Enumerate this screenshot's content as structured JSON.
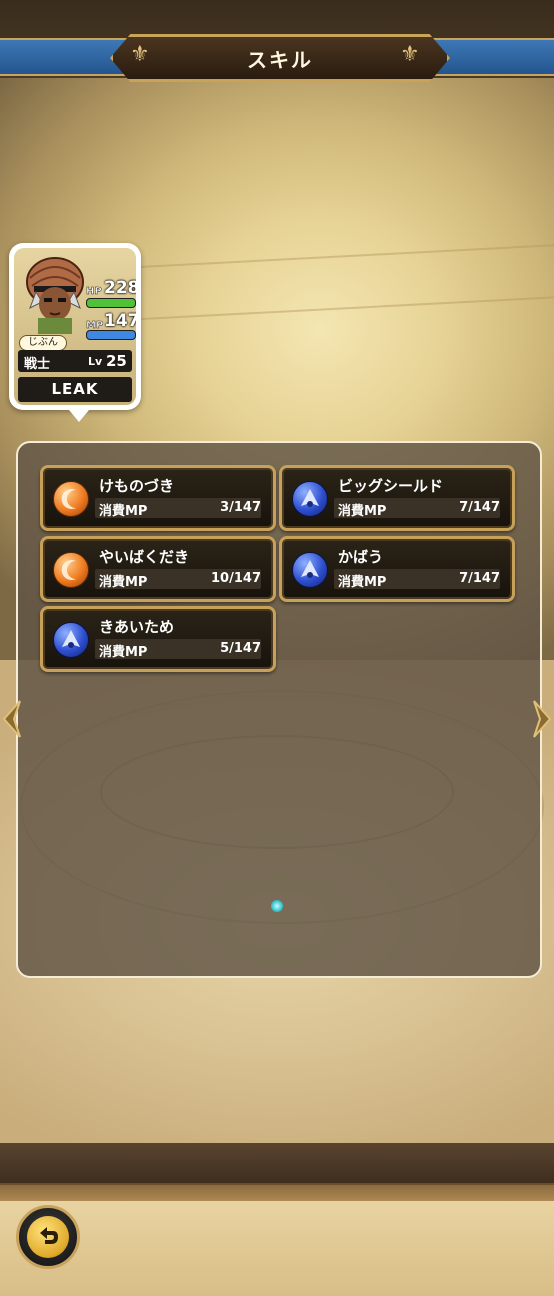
{
  "header": {
    "title": "スキル"
  },
  "character": {
    "hp_label": "HP",
    "hp": "228",
    "mp_label": "MP",
    "mp": "147",
    "tag": "じぶん",
    "class": "戦士",
    "level_prefix": "Lv",
    "level": "25",
    "name": "LEAK"
  },
  "skills": [
    {
      "name": "けものづき",
      "cost_label": "消費MP",
      "cost": "3/147",
      "icon": "orange-crescent-icon"
    },
    {
      "name": "ビッグシールド",
      "cost_label": "消費MP",
      "cost": "7/147",
      "icon": "blue-shield-icon"
    },
    {
      "name": "やいばくだき",
      "cost_label": "消費MP",
      "cost": "10/147",
      "icon": "orange-crescent-icon"
    },
    {
      "name": "かばう",
      "cost_label": "消費MP",
      "cost": "7/147",
      "icon": "blue-shield-icon"
    },
    {
      "name": "きあいため",
      "cost_label": "消費MP",
      "cost": "5/147",
      "icon": "blue-shield-icon"
    }
  ],
  "colors": {
    "accent_gold": "#c7a15a",
    "header_blue": "#2f69a8",
    "hp_green": "#4fc23a",
    "mp_blue": "#3f87e0"
  }
}
